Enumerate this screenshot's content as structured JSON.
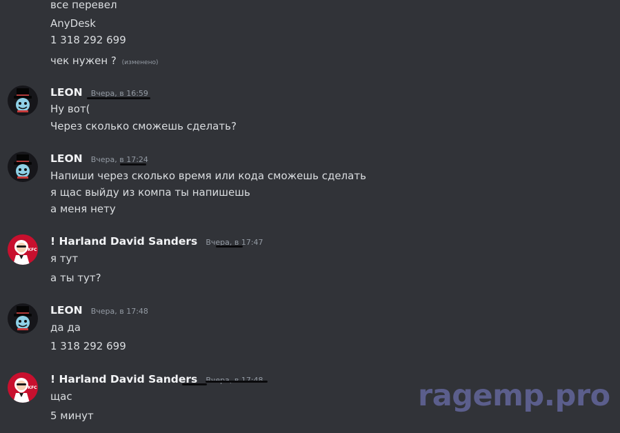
{
  "top_messages": [
    {
      "text": "все перевел"
    },
    {
      "text": "AnyDesk"
    },
    {
      "text": "1 318 292 699"
    },
    {
      "text": "чек нужен ?",
      "edited": "(изменено)"
    }
  ],
  "messages": [
    {
      "author": "LEON",
      "timestamp": "Вчера, в 16:59",
      "avatar": "leon-avatar",
      "lines": [
        "Ну вот(",
        "Через сколько сможешь сделать?"
      ]
    },
    {
      "author": "LEON",
      "timestamp": "Вчера, в 17:24",
      "avatar": "leon-avatar",
      "lines": [
        "Напиши через сколько время или кода сможешь сделать",
        "я щас выйду из компа ты напишешь",
        "а меня нету"
      ]
    },
    {
      "author": "! Harland David Sanders",
      "timestamp": "Вчера, в 17:47",
      "avatar": "kfc-avatar",
      "lines": [
        "я тут",
        "а ты тут?"
      ]
    },
    {
      "author": "LEON",
      "timestamp": "Вчера, в 17:48",
      "avatar": "leon-avatar",
      "lines": [
        "да да",
        "1 318 292 699"
      ]
    },
    {
      "author": "! Harland David Sanders",
      "timestamp": "Вчера, в 17:48",
      "avatar": "kfc-avatar",
      "lines": [
        "щас",
        "5 минут"
      ]
    }
  ],
  "watermark": "ragemp.pro",
  "colors": {
    "background": "#313338",
    "text": "#dbdee1",
    "author": "#f2f3f5",
    "timestamp": "#949ba4",
    "watermark": "#5f6294"
  }
}
